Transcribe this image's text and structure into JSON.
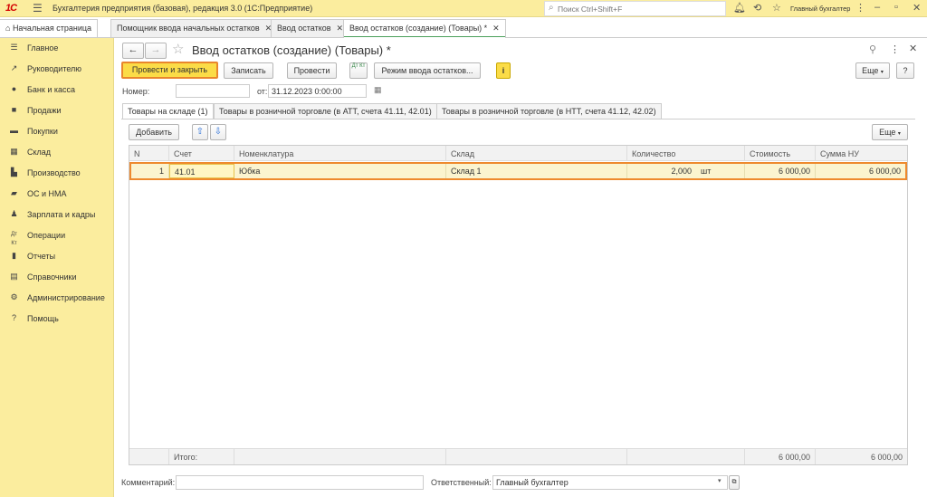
{
  "app": {
    "logo": "1С",
    "title": "Бухгалтерия предприятия (базовая), редакция 3.0  (1С:Предприятие)",
    "search_placeholder": "Поиск Ctrl+Shift+F",
    "user": "Главный бухгалтер"
  },
  "tabs": [
    {
      "label": "Начальная страница"
    },
    {
      "label": "Помощник ввода начальных остатков"
    },
    {
      "label": "Ввод остатков"
    },
    {
      "label": "Ввод остатков (создание) (Товары) *"
    }
  ],
  "sidebar": {
    "items": [
      {
        "label": "Главное",
        "icon": "menu-icon"
      },
      {
        "label": "Руководителю",
        "icon": "trend-icon"
      },
      {
        "label": "Банк и касса",
        "icon": "coin-icon"
      },
      {
        "label": "Продажи",
        "icon": "bag-icon"
      },
      {
        "label": "Покупки",
        "icon": "cart-icon"
      },
      {
        "label": "Склад",
        "icon": "box-icon"
      },
      {
        "label": "Производство",
        "icon": "factory-icon"
      },
      {
        "label": "ОС и НМА",
        "icon": "truck-icon"
      },
      {
        "label": "Зарплата и кадры",
        "icon": "person-icon"
      },
      {
        "label": "Операции",
        "icon": "dt-kt-icon"
      },
      {
        "label": "Отчеты",
        "icon": "bar-chart-icon"
      },
      {
        "label": "Справочники",
        "icon": "book-icon"
      },
      {
        "label": "Администрирование",
        "icon": "gear-icon"
      },
      {
        "label": "Помощь",
        "icon": "question-icon"
      }
    ]
  },
  "form": {
    "title": "Ввод остатков (создание) (Товары) *",
    "toolbar": {
      "post_close": "Провести и закрыть",
      "save": "Записать",
      "post": "Провести",
      "dtkt": "Дт Кт",
      "mode": "Режим ввода остатков...",
      "info": "i",
      "more": "Еще",
      "help": "?"
    },
    "number_label": "Номер:",
    "number_value": "",
    "date_label": "от:",
    "date_value": "31.12.2023  0:00:00",
    "tabs": [
      "Товары на складе (1)",
      "Товары в розничной торговле (в АТТ, счета 41.11, 42.01)",
      "Товары в розничной торговле (в НТТ, счета 41.12, 42.02)"
    ],
    "add_button": "Добавить",
    "grid_more": "Еще",
    "columns": [
      "N",
      "Счет",
      "Номенклатура",
      "Склад",
      "Количество",
      "Стоимость",
      "Сумма НУ"
    ],
    "rows": [
      {
        "n": "1",
        "account": "41.01",
        "item": "Юбка",
        "warehouse": "Склад 1",
        "qty": "2,000",
        "unit": "шт",
        "cost": "6 000,00",
        "sum_nu": "6 000,00"
      }
    ],
    "footer": {
      "label": "Итого:",
      "cost": "6 000,00",
      "sum_nu": "6 000,00"
    },
    "comment_label": "Комментарий:",
    "comment_value": "",
    "responsible_label": "Ответственный:",
    "responsible_value": "Главный бухгалтер"
  },
  "colors": {
    "accent_yellow": "#fbed9e",
    "primary_button": "#fbdc47",
    "highlight_border": "#ee8a2e"
  }
}
